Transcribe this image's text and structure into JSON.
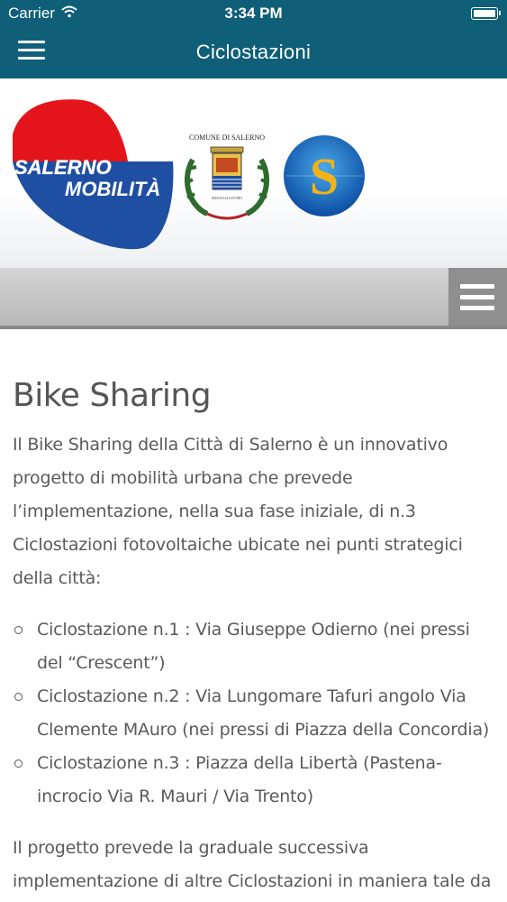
{
  "status_bar": {
    "carrier": "Carrier",
    "time": "3:34 PM"
  },
  "nav": {
    "title": "Ciclostazioni"
  },
  "logos": {
    "salerno_mobilita": {
      "line1": "SALERNO",
      "line2": "MOBILITÀ"
    },
    "comune": {
      "text": "COMUNE DI SALERNO"
    }
  },
  "content": {
    "heading": "Bike Sharing",
    "intro": "Il Bike Sharing della Città di Salerno è un innovativo progetto di mobilità urbana che prevede l’implementazione, nella sua fase iniziale, di n.3 Ciclostazioni fotovoltaiche ubicate nei punti strategici della città:",
    "stations": [
      "Ciclostazione n.1 : Via Giuseppe Odierno (nei pressi del “Crescent”)",
      "Ciclostazione n.2 : Via Lungomare Tafuri angolo Via Clemente MAuro (nei pressi di Piazza della Concordia)",
      "Ciclostazione n.3 : Piazza della Libertà (Pastena-incrocio Via R. Mauri / Via Trento)"
    ],
    "outro": "Il progetto prevede la graduale successiva implementazione di altre Ciclostazioni in maniera tale da"
  },
  "colors": {
    "nav_background": "#0e5f77",
    "logo_red": "#e3151b",
    "logo_blue": "#1f4fa3"
  }
}
